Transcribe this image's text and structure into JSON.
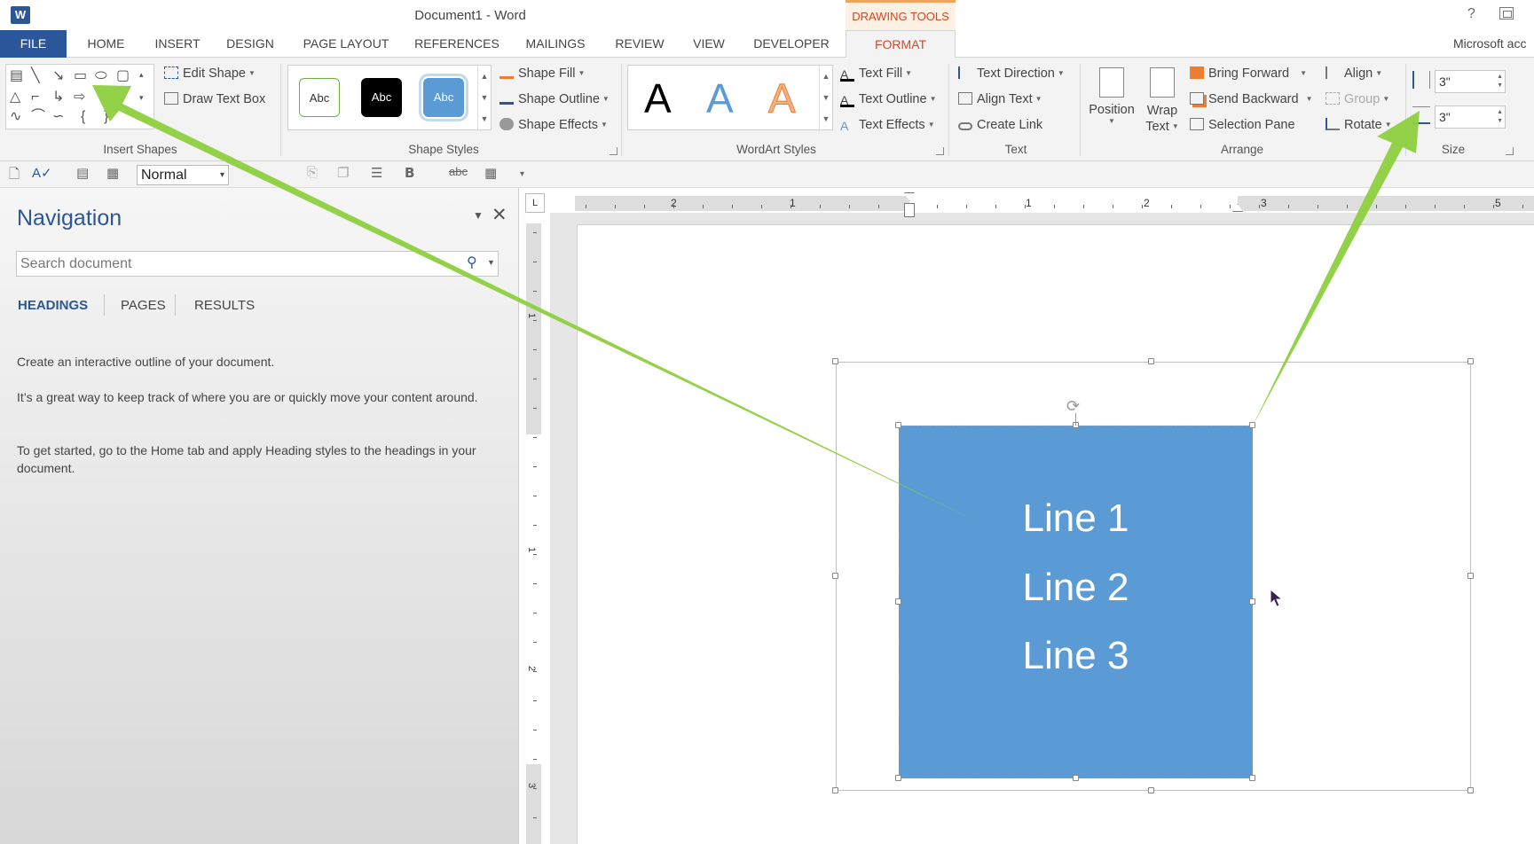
{
  "window": {
    "title": "Document1 - Word",
    "logo": "W",
    "context_header": "DRAWING TOOLS",
    "account": "Microsoft acc",
    "help": "?"
  },
  "tabs": [
    "FILE",
    "HOME",
    "INSERT",
    "DESIGN",
    "PAGE LAYOUT",
    "REFERENCES",
    "MAILINGS",
    "REVIEW",
    "VIEW",
    "DEVELOPER",
    "FORMAT"
  ],
  "ribbon": {
    "insert_shapes": {
      "label": "Insert Shapes",
      "edit_shape": "Edit Shape",
      "draw_text_box": "Draw Text Box"
    },
    "shape_styles": {
      "label": "Shape Styles",
      "swatch": "Abc",
      "shape_fill": "Shape Fill",
      "shape_outline": "Shape Outline",
      "shape_effects": "Shape Effects"
    },
    "wordart_styles": {
      "label": "WordArt Styles",
      "glyph": "A",
      "text_fill": "Text Fill",
      "text_outline": "Text Outline",
      "text_effects": "Text Effects"
    },
    "text": {
      "label": "Text",
      "text_direction": "Text Direction",
      "align_text": "Align Text",
      "create_link": "Create Link"
    },
    "arrange": {
      "label": "Arrange",
      "position": "Position",
      "wrap": "Wrap",
      "wrap_text": "Text",
      "bring_forward": "Bring Forward",
      "send_backward": "Send Backward",
      "selection_pane": "Selection Pane",
      "align": "Align",
      "group": "Group",
      "rotate": "Rotate"
    },
    "size": {
      "label": "Size",
      "height": "3\"",
      "width": "3\""
    }
  },
  "quick_toolbar": {
    "style_value": "Normal",
    "bold": "B",
    "strikethrough": "abc"
  },
  "navigation": {
    "title": "Navigation",
    "search_placeholder": "Search document",
    "tabs": [
      "HEADINGS",
      "PAGES",
      "RESULTS"
    ],
    "paragraphs": [
      "Create an interactive outline of your document.",
      "It’s a great way to keep track of where you are or quickly move your content around.",
      "To get started, go to the Home tab and apply Heading styles to the headings in your document."
    ]
  },
  "ruler": {
    "corner": "L",
    "h_numbers": [
      "2",
      "1",
      "1",
      "2",
      "3",
      "5"
    ],
    "v_numbers": [
      "1",
      "1",
      "2",
      "3"
    ]
  },
  "document": {
    "shape_lines": [
      "Line 1",
      "Line 2",
      "Line 3"
    ]
  },
  "colors": {
    "brand_blue": "#2b579a",
    "context_orange": "#d24726",
    "shape_fill": "#5b9bd5",
    "annotation_arrow": "#8dcf3f"
  },
  "icons": {
    "arrows": "annotation-arrow-icon",
    "cursor": "mouse-pointer-icon",
    "rotate": "rotate-handle-icon"
  }
}
